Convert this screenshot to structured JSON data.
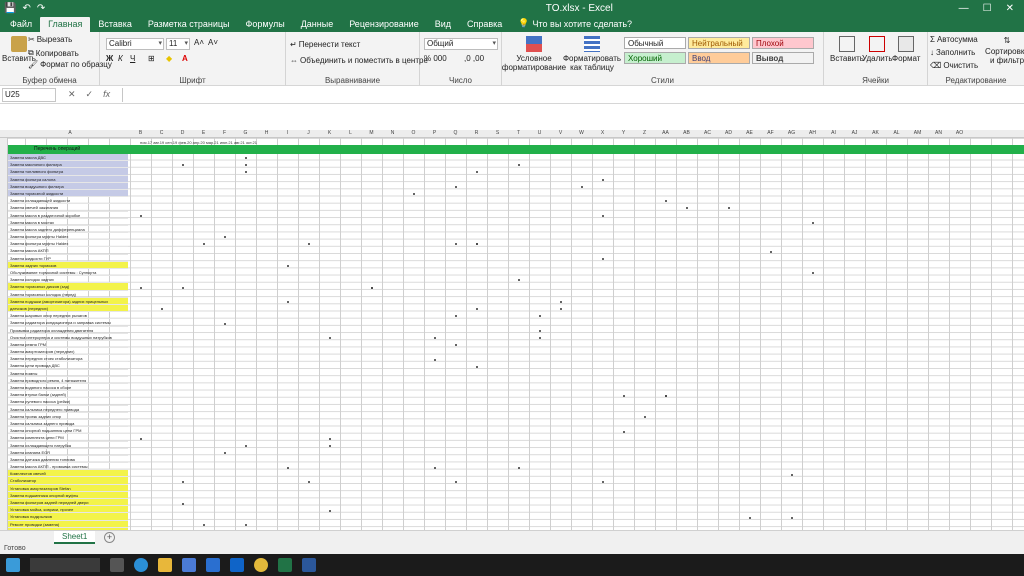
{
  "titlebar": {
    "title": "TO.xlsx  -  Excel"
  },
  "tabs": [
    "Файл",
    "Главная",
    "Вставка",
    "Разметка страницы",
    "Формулы",
    "Данные",
    "Рецензирование",
    "Вид",
    "Справка"
  ],
  "tell_me": "Что вы хотите сделать?",
  "ribbon": {
    "clipboard": {
      "paste": "Вставить",
      "cut": "Вырезать",
      "copy": "Копировать",
      "format_painter": "Формат по образцу",
      "label": "Буфер обмена"
    },
    "font": {
      "name": "Calibri",
      "size": "11",
      "label": "Шрифт"
    },
    "alignment": {
      "wrap": "Перенести текст",
      "merge": "Объединить и поместить в центре",
      "label": "Выравнивание"
    },
    "number": {
      "format": "Общий",
      "label": "Число"
    },
    "styles": {
      "conditional": "Условное форматирование",
      "table": "Форматировать как таблицу",
      "cells": [
        "Обычный",
        "Нейтральный",
        "Плохой",
        "Хороший",
        "Ввод",
        "Вывод"
      ],
      "label": "Стили"
    },
    "cells": {
      "insert": "Вставить",
      "delete": "Удалить",
      "format": "Формат",
      "label": "Ячейки"
    },
    "editing": {
      "autosum": "Автосумма",
      "fill": "Заполнить",
      "clear": "Очистить",
      "sort": "Сортировка и фильтр",
      "label": "Редактирование"
    }
  },
  "formula_bar": {
    "name_box": "U25",
    "cancel": "✕",
    "enter": "✓",
    "fx": "fx"
  },
  "sheet": {
    "columns": [
      "A",
      "B",
      "C",
      "D",
      "E",
      "F",
      "G",
      "H",
      "I",
      "J",
      "K",
      "L",
      "M",
      "N",
      "O",
      "P",
      "Q",
      "R",
      "S",
      "T",
      "U",
      "V",
      "W",
      "X",
      "Y",
      "Z",
      "AA",
      "AB",
      "AC",
      "AD",
      "AE",
      "AF",
      "AG",
      "AH",
      "AI",
      "AJ",
      "AK",
      "AL",
      "AM",
      "AN",
      "AO"
    ],
    "header_text": "Перечень операций",
    "month_labels": "ноя.17   авг.19  сен.19  фев.20  апр.20   мар.21  июн.21  авг.21  окт.21",
    "rows": [
      {
        "text": "Замена масла ДВС",
        "style": "blue"
      },
      {
        "text": "Замена масляного фильтра",
        "style": "blue"
      },
      {
        "text": "Замена топливного фильтра",
        "style": "blue"
      },
      {
        "text": "Замена фильтра салона",
        "style": "blue"
      },
      {
        "text": "Замена воздушного фильтра",
        "style": "blue"
      },
      {
        "text": "Замена тормозной жидкости",
        "style": "blue"
      },
      {
        "text": "Замена охлаждающей жидкости",
        "style": ""
      },
      {
        "text": "Замена свечей зажигания",
        "style": ""
      },
      {
        "text": "Замена масла в раздаточной коробке",
        "style": ""
      },
      {
        "text": "Замена масла в мостах",
        "style": ""
      },
      {
        "text": "Замена масла заднего дифференциала",
        "style": ""
      },
      {
        "text": "Замена фильтра муфты Haldex",
        "style": ""
      },
      {
        "text": "Замена фильтра муфты Haldex",
        "style": ""
      },
      {
        "text": "Замена масла АКПП",
        "style": ""
      },
      {
        "text": "Замена жидкости ГУР",
        "style": ""
      },
      {
        "text": "Замена задних тормозов",
        "style": "yellow"
      },
      {
        "text": "Обслуживание тормозной системы : Суппорта",
        "style": ""
      },
      {
        "text": "Замена колодок задних",
        "style": ""
      },
      {
        "text": "Замена тормозных дисков (зад)",
        "style": "yellow"
      },
      {
        "text": "Замена тормозных колодок (перед)",
        "style": ""
      },
      {
        "text": "Замена подушки (амортизатора) задних прицельных",
        "style": "yellow"
      },
      {
        "text": "датчиков (передних)",
        "style": "yellow"
      },
      {
        "text": "Замена шаровых опор передних рычагов",
        "style": ""
      },
      {
        "text": "Замена радиатора кондиционера и заправка системы",
        "style": ""
      },
      {
        "text": "Промывка радиатора охлаждения двигателя",
        "style": ""
      },
      {
        "text": "Очистка интеркулера и системы воздушных патрубков",
        "style": ""
      },
      {
        "text": "Замена ремня ГРМ",
        "style": ""
      },
      {
        "text": "Замена амортизаторов (передних)",
        "style": ""
      },
      {
        "text": "Замена передних стоек стабилизатора",
        "style": ""
      },
      {
        "text": "Замена цепи привода ДВС",
        "style": ""
      },
      {
        "text": "Замена помпы",
        "style": ""
      },
      {
        "text": "Замена приводного ремня, 4 натяжителя",
        "style": ""
      },
      {
        "text": "Замена водяного насоса в сборе",
        "style": ""
      },
      {
        "text": "Замена втулки балки (задней)",
        "style": ""
      },
      {
        "text": "Замена рулевого насоса (рейки)",
        "style": ""
      },
      {
        "text": "Замена сальника переднего привода",
        "style": ""
      },
      {
        "text": "Замена троекк задних опор",
        "style": ""
      },
      {
        "text": "Замена сальника заднего привода",
        "style": ""
      },
      {
        "text": "Замена опорной подшипник цепи ГРМ",
        "style": ""
      },
      {
        "text": "Замена комплекта цепи ГРМ",
        "style": ""
      },
      {
        "text": "Замена охлаждающего патрубка",
        "style": ""
      },
      {
        "text": "Замена клапана EGR",
        "style": ""
      },
      {
        "text": "Замена датчика давления топлива",
        "style": ""
      },
      {
        "text": "Замена масла АКПП - промывка системы",
        "style": ""
      },
      {
        "text": "Комплектов свечей",
        "style": "yellow"
      },
      {
        "text": "Стабилизатор",
        "style": "yellow"
      },
      {
        "text": "Установка амортизаторов Stefan",
        "style": "yellow"
      },
      {
        "text": "Замена подшипника опорной муфты",
        "style": "yellow"
      },
      {
        "text": "Замена фильтров задней передней двери",
        "style": "yellow"
      },
      {
        "text": "Установка мойка, коврики, прочее",
        "style": "yellow"
      },
      {
        "text": "Установка подкрылков",
        "style": "yellow"
      },
      {
        "text": "Ремонт проводки (замена)",
        "style": "yellow"
      },
      {
        "text": "обвязки, обивки, муфта сцепления",
        "style": "yellow"
      },
      {
        "text": "и кабины, по суть, проводка и",
        "style": "yellow"
      },
      {
        "text": "замена обшивки",
        "style": "yellow"
      },
      {
        "text": "прочее",
        "style": "yellow"
      },
      {
        "text": "Ремонт фильтра замены",
        "style": "yellow"
      }
    ]
  },
  "sheet_tab": "Sheet1",
  "status": "Готово",
  "taskbar": {
    "search": ""
  }
}
